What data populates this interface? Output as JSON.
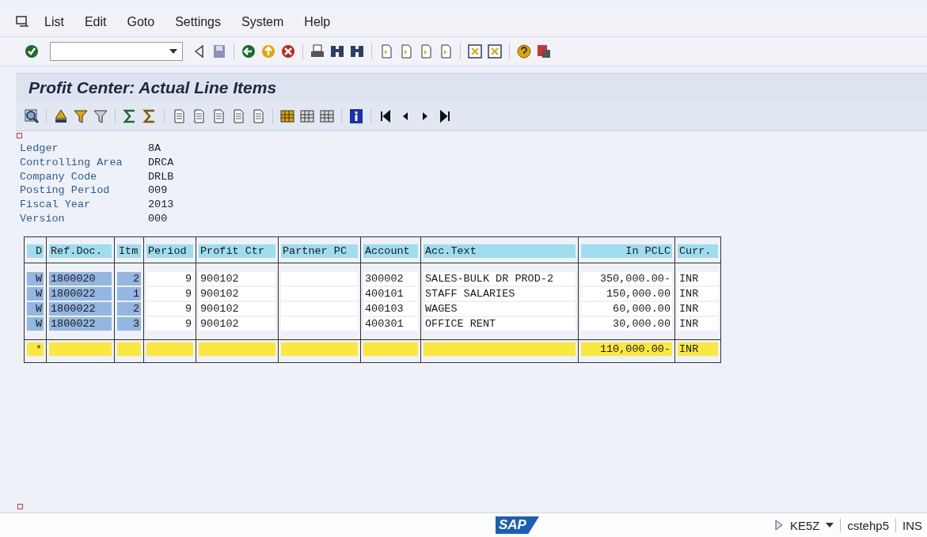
{
  "menu": [
    "List",
    "Edit",
    "Goto",
    "Settings",
    "System",
    "Help"
  ],
  "title": "Profit Center: Actual Line Items",
  "header_fields": [
    {
      "label": "Ledger",
      "value": "8A"
    },
    {
      "label": "Controlling Area",
      "value": "DRCA"
    },
    {
      "label": "Company Code",
      "value": "DRLB"
    },
    {
      "label": "Posting Period",
      "value": "009"
    },
    {
      "label": "Fiscal Year",
      "value": "2013"
    },
    {
      "label": "Version",
      "value": "000"
    }
  ],
  "table": {
    "columns": [
      "D",
      "Ref.Doc.",
      "Itm",
      "Period",
      "Profit Ctr",
      "Partner PC",
      "Account",
      "Acc.Text",
      "In PCLC",
      "Curr."
    ],
    "rows": [
      {
        "kind": "item",
        "cells": [
          "W",
          "1800020",
          "2",
          "9",
          "900102",
          "",
          "300002",
          "SALES-BULK DR PROD-2",
          "350,000.00-",
          "INR"
        ]
      },
      {
        "kind": "item",
        "cells": [
          "W",
          "1800022",
          "1",
          "9",
          "900102",
          "",
          "400101",
          "STAFF SALARIES",
          "150,000.00",
          "INR"
        ]
      },
      {
        "kind": "item",
        "cells": [
          "W",
          "1800022",
          "2",
          "9",
          "900102",
          "",
          "400103",
          "WAGES",
          "60,000.00",
          "INR"
        ]
      },
      {
        "kind": "item",
        "cells": [
          "W",
          "1800022",
          "3",
          "9",
          "900102",
          "",
          "400301",
          "OFFICE RENT",
          "30,000.00",
          "INR"
        ]
      },
      {
        "kind": "total",
        "cells": [
          "*",
          "",
          "",
          "",
          "",
          "",
          "",
          "",
          "110,000.00-",
          "INR"
        ]
      }
    ]
  },
  "status_bar": {
    "logo": "SAP",
    "transaction": "KE5Z",
    "server": "cstehp5",
    "mode": "INS"
  }
}
